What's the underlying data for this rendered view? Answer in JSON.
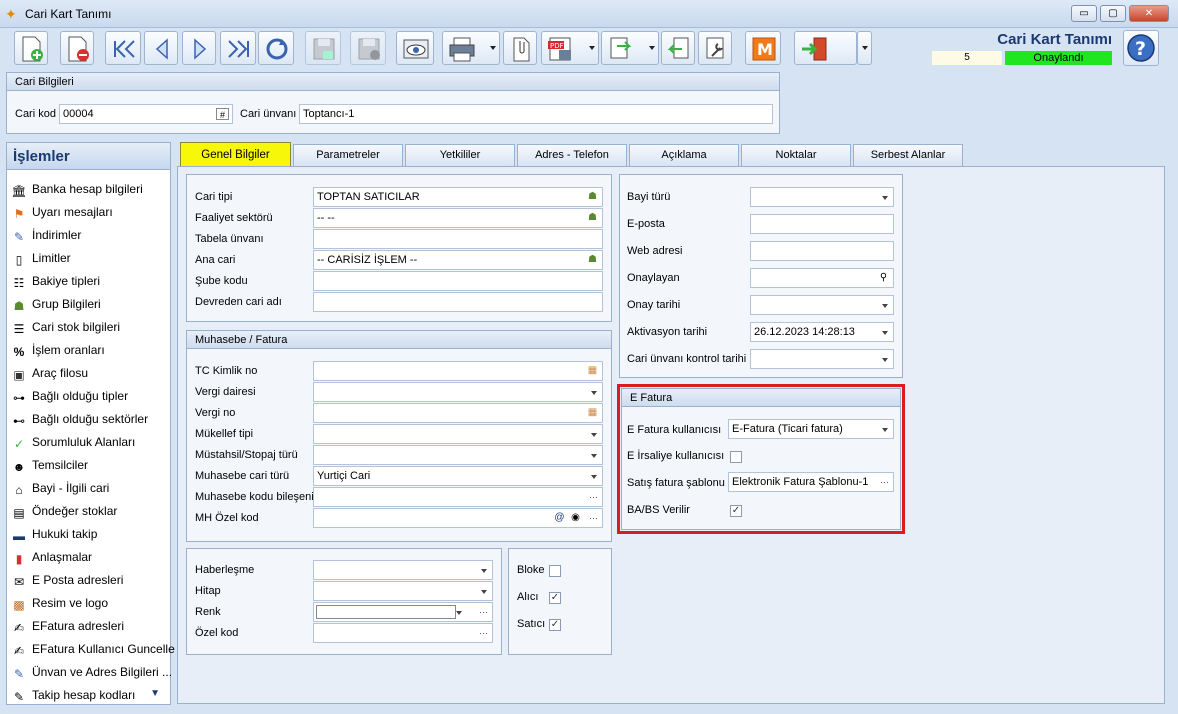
{
  "window": {
    "title": "Cari Kart Tanımı",
    "minimize": "▭",
    "maximize": "▢",
    "close": "✕"
  },
  "header": {
    "title": "Cari Kart Tanımı",
    "count": "5",
    "status": "Onaylandı"
  },
  "cari_bilgileri": {
    "title": "Cari Bilgileri",
    "kod_label": "Cari kod",
    "kod_value": "00004",
    "unvan_label": "Cari ünvanı",
    "unvan_value": "Toptancı-1"
  },
  "sidebar": {
    "title": "İşlemler",
    "items": [
      {
        "label": "Banka hesap bilgileri",
        "icon": "bank-icon"
      },
      {
        "label": "Uyarı mesajları",
        "icon": "warning-icon"
      },
      {
        "label": "İndirimler",
        "icon": "discount-icon"
      },
      {
        "label": "Limitler",
        "icon": "limit-icon"
      },
      {
        "label": "Bakiye tipleri",
        "icon": "balance-icon"
      },
      {
        "label": "Grup Bilgileri",
        "icon": "group-icon"
      },
      {
        "label": "Cari stok bilgileri",
        "icon": "stock-icon"
      },
      {
        "label": "İşlem oranları",
        "icon": "percent-icon"
      },
      {
        "label": "Araç filosu",
        "icon": "vehicle-icon"
      },
      {
        "label": "Bağlı olduğu tipler",
        "icon": "type-icon"
      },
      {
        "label": "Bağlı olduğu sektörler",
        "icon": "sector-icon"
      },
      {
        "label": "Sorumluluk Alanları",
        "icon": "responsibility-icon"
      },
      {
        "label": "Temsilciler",
        "icon": "person-icon"
      },
      {
        "label": "Bayi - İlgili cari",
        "icon": "dealer-icon"
      },
      {
        "label": "Öndeğer stoklar",
        "icon": "default-stock-icon"
      },
      {
        "label": "Hukuki takip",
        "icon": "legal-icon"
      },
      {
        "label": "Anlaşmalar",
        "icon": "agreement-icon"
      },
      {
        "label": "E Posta adresleri",
        "icon": "email-icon"
      },
      {
        "label": "Resim ve logo",
        "icon": "image-icon"
      },
      {
        "label": "EFatura adresleri",
        "icon": "efatura-icon"
      },
      {
        "label": "EFatura Kullanıcı Guncelle",
        "icon": "efatura-update-icon"
      },
      {
        "label": "Ünvan ve Adres Bilgileri ...",
        "icon": "address-icon"
      },
      {
        "label": "Takip hesap kodları",
        "icon": "tracking-icon"
      }
    ]
  },
  "tabs": [
    {
      "label": "Genel Bilgiler"
    },
    {
      "label": "Parametreler"
    },
    {
      "label": "Yetkililer"
    },
    {
      "label": "Adres - Telefon"
    },
    {
      "label": "Açıklama"
    },
    {
      "label": "Noktalar"
    },
    {
      "label": "Serbest Alanlar"
    }
  ],
  "genel": {
    "cari_tipi_label": "Cari tipi",
    "cari_tipi_value": "TOPTAN SATICILAR",
    "faaliyet_label": "Faaliyet sektörü",
    "faaliyet_value": "-- --",
    "tabela_label": "Tabela ünvanı",
    "tabela_value": "",
    "ana_cari_label": "Ana cari",
    "ana_cari_value": "-- CARİSİZ İŞLEM --",
    "sube_label": "Şube kodu",
    "sube_value": "",
    "devreden_label": "Devreden cari adı",
    "devreden_value": ""
  },
  "muhasebe": {
    "title": "Muhasebe / Fatura",
    "tc_label": "TC Kimlik no",
    "vergi_dairesi_label": "Vergi dairesi",
    "vergi_no_label": "Vergi no",
    "mukellef_label": "Mükellef tipi",
    "mustahsil_label": "Müstahsil/Stopaj türü",
    "muh_cari_turu_label": "Muhasebe cari türü",
    "muh_cari_turu_value": "Yurtiçi Cari",
    "muh_kodu_label": "Muhasebe kodu bileşeni",
    "mh_ozel_label": "MH Özel kod"
  },
  "diger": {
    "haberlesme_label": "Haberleşme",
    "hitap_label": "Hitap",
    "renk_label": "Renk",
    "ozel_kod_label": "Özel kod",
    "bloke_label": "Bloke",
    "bloke_checked": false,
    "alici_label": "Alıcı",
    "alici_checked": true,
    "satici_label": "Satıcı",
    "satici_checked": true
  },
  "bayi": {
    "bayi_turu_label": "Bayi türü",
    "eposta_label": "E-posta",
    "web_label": "Web adresi",
    "onaylayan_label": "Onaylayan",
    "onay_tarihi_label": "Onay tarihi",
    "aktivasyon_label": "Aktivasyon tarihi",
    "aktivasyon_value": "26.12.2023 14:28:13",
    "unvan_kontrol_label": "Cari ünvanı kontrol tarihi"
  },
  "efatura": {
    "title": "E Fatura",
    "kullanici_label": "E Fatura kullanıcısı",
    "kullanici_value": "E-Fatura (Ticari fatura)",
    "irsaliye_label": "E İrsaliye kullanıcısı",
    "irsaliye_checked": false,
    "sablon_label": "Satış fatura şablonu",
    "sablon_value": "Elektronik Fatura Şablonu-1",
    "babs_label": "BA/BS Verilir",
    "babs_checked": true
  },
  "colors": {
    "status_green": "#22e522",
    "active_tab": "#f7f70a",
    "highlight_red": "#d91d1d",
    "title_blue": "#1b3a72"
  }
}
